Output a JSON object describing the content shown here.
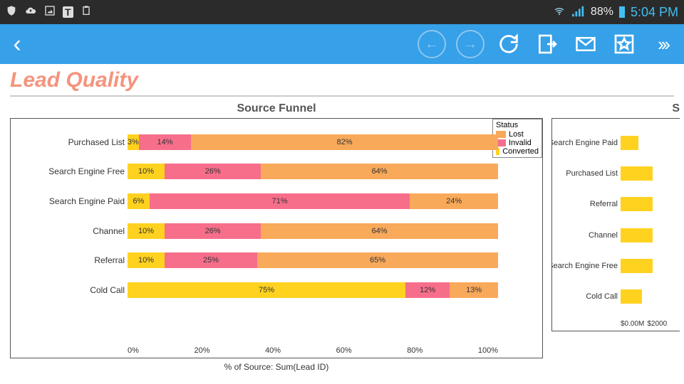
{
  "status": {
    "battery_pct": "88%",
    "time": "5:04 PM"
  },
  "page": {
    "title": "Lead Quality"
  },
  "chart_data": [
    {
      "type": "bar",
      "title": "Source Funnel",
      "orientation": "horizontal",
      "stacked": true,
      "xlabel": "% of Source: Sum(Lead ID)",
      "xlim": [
        0,
        100
      ],
      "x_ticks": [
        "0%",
        "20%",
        "40%",
        "60%",
        "80%",
        "100%"
      ],
      "legend_title": "Status",
      "legend": [
        "Lost",
        "Invalid",
        "Converted"
      ],
      "categories": [
        "Purchased List",
        "Search Engine Free",
        "Search Engine Paid",
        "Channel",
        "Referral",
        "Cold Call"
      ],
      "series": [
        {
          "name": "Converted",
          "color": "#ffd21f",
          "values": [
            3,
            10,
            6,
            10,
            10,
            75
          ]
        },
        {
          "name": "Invalid",
          "color": "#f76e8b",
          "values": [
            14,
            26,
            71,
            26,
            25,
            12
          ]
        },
        {
          "name": "Lost",
          "color": "#f9a95a",
          "values": [
            82,
            64,
            24,
            64,
            65,
            13
          ]
        }
      ]
    },
    {
      "type": "bar",
      "title": "S",
      "orientation": "horizontal",
      "categories": [
        "Search Engine Paid",
        "Purchased List",
        "Referral",
        "Channel",
        "Search Engine Free",
        "Cold Call"
      ],
      "values": [
        25,
        45,
        45,
        45,
        45,
        30
      ],
      "x_ticks": [
        "$0.00M",
        "$2000"
      ],
      "note": "partially visible; values estimated from cropped view"
    }
  ]
}
